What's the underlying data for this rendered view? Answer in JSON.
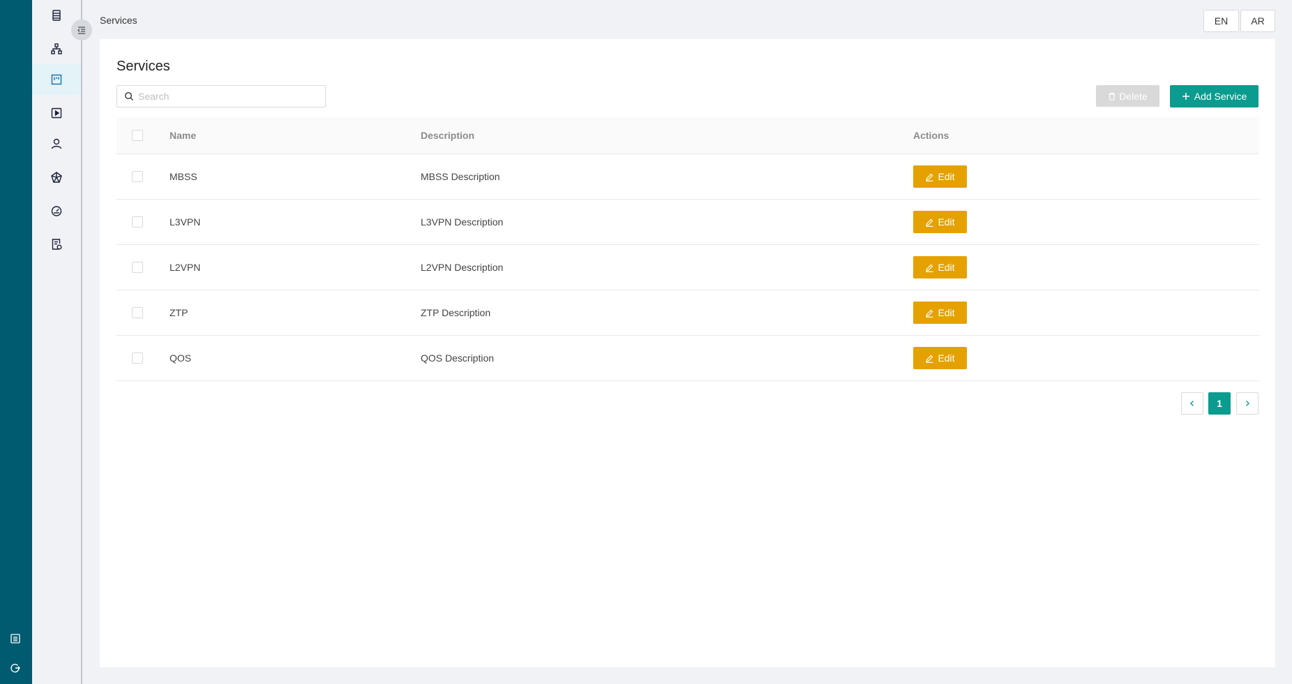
{
  "breadcrumb": "Services",
  "language": {
    "en": "EN",
    "ar": "AR"
  },
  "page": {
    "title": "Services"
  },
  "search": {
    "placeholder": "Search"
  },
  "toolbar": {
    "delete_label": "Delete",
    "add_label": "Add Service"
  },
  "table": {
    "columns": {
      "name": "Name",
      "description": "Description",
      "actions": "Actions"
    },
    "rows": [
      {
        "name": "MBSS",
        "description": "MBSS Description",
        "action": "Edit"
      },
      {
        "name": "L3VPN",
        "description": "L3VPN Description",
        "action": "Edit"
      },
      {
        "name": "L2VPN",
        "description": "L2VPN Description",
        "action": "Edit"
      },
      {
        "name": "ZTP",
        "description": "ZTP Description",
        "action": "Edit"
      },
      {
        "name": "QOS",
        "description": "QOS Description",
        "action": "Edit"
      }
    ]
  },
  "pagination": {
    "current": "1"
  },
  "sidebar": {
    "items": [
      "server-list-icon",
      "network-topology-icon",
      "services-board-icon",
      "play-icon",
      "user-icon",
      "network-graph-icon",
      "dashboard-gauge-icon",
      "document-settings-icon"
    ],
    "active_index": 2
  },
  "colors": {
    "rail": "#005a70",
    "primary": "#0b9b8f",
    "edit": "#e5a100",
    "disabled": "#d9d9d9"
  }
}
